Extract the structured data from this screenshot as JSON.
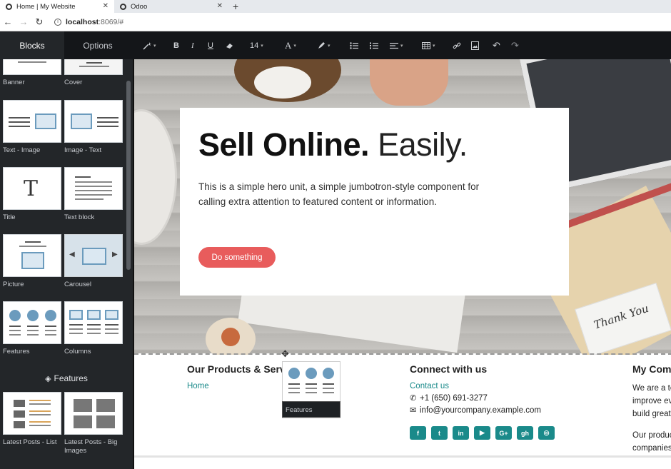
{
  "browser": {
    "tabs": [
      {
        "title": "Home | My Website",
        "active": true
      },
      {
        "title": "Odoo",
        "active": false
      }
    ],
    "new_tab": "+",
    "close_glyph": "✕",
    "url_host": "localhost",
    "url_rest": ":8069/#",
    "nav": {
      "back": "←",
      "forward": "→",
      "reload": "↻",
      "info": "i"
    }
  },
  "editor": {
    "tabs": [
      "Blocks",
      "Options"
    ],
    "font_size": "14",
    "toolbar_icons": [
      "magic-wand-icon",
      "bold-icon",
      "italic-icon",
      "underline-icon",
      "eraser-icon",
      "font-size-icon",
      "font-color-icon",
      "highlight-icon",
      "bullet-list-icon",
      "numbered-list-icon",
      "align-icon",
      "table-icon",
      "link-icon",
      "image-icon",
      "undo-icon",
      "redo-icon"
    ],
    "toolbar_glyphs": {
      "bold": "B",
      "italic": "I",
      "underline": "U",
      "font_color": "A",
      "undo": "↶",
      "redo": "↷",
      "caret": "▾"
    }
  },
  "sidebar": {
    "snippets": [
      {
        "label": "Banner"
      },
      {
        "label": "Cover"
      },
      {
        "label": "Text - Image"
      },
      {
        "label": "Image - Text"
      },
      {
        "label": "Title"
      },
      {
        "label": "Text block"
      },
      {
        "label": "Picture"
      },
      {
        "label": "Carousel"
      },
      {
        "label": "Features"
      },
      {
        "label": "Columns"
      }
    ],
    "section_title": "Features",
    "feature_snippets": [
      {
        "label": "Latest Posts - List"
      },
      {
        "label": "Latest Posts - Big Images"
      }
    ],
    "title_glyph": "T",
    "carousel_arrows": [
      "◀",
      "▶"
    ],
    "gem_glyph": "◈"
  },
  "hero": {
    "title_strong": "Sell Online.",
    "title_light": "Easily.",
    "lead": "This is a simple hero unit, a simple jumbotron-style component for calling extra attention to featured content or information.",
    "button": "Do something",
    "tag_text": "Thank You",
    "button_color": "#e85c5c"
  },
  "drag": {
    "ghost_label": "Features",
    "move_glyph": "✥"
  },
  "footer": {
    "col1": {
      "heading": "Our Products & Serv",
      "links": [
        "Home"
      ]
    },
    "col2": {
      "heading": "Connect with us",
      "link": "Contact us",
      "phone": "+1 (650) 691-3277",
      "email": "info@yourcompany.example.com",
      "phone_glyph": "✆",
      "email_glyph": "✉",
      "social": [
        "facebook-icon",
        "twitter-icon",
        "linkedin-icon",
        "youtube-icon",
        "google-plus-icon",
        "github-icon",
        "instagram-icon"
      ],
      "social_glyphs": [
        "f",
        "t",
        "in",
        "▶",
        "G+",
        "gh",
        "◎"
      ]
    },
    "col3": {
      "heading": "My Comp",
      "lines": [
        "We are a te",
        "improve ev",
        "build great",
        "",
        "Our produc",
        "companies"
      ]
    },
    "accent": "#1a8a8a"
  }
}
